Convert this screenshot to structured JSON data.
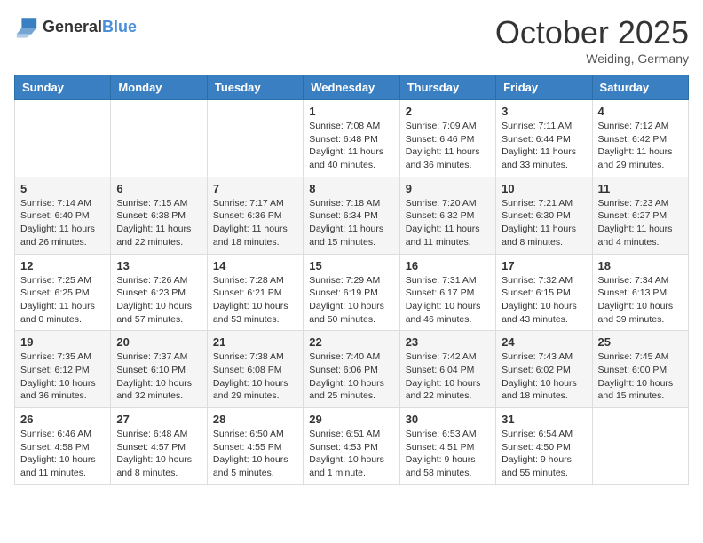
{
  "header": {
    "logo_general": "General",
    "logo_blue": "Blue",
    "month": "October 2025",
    "location": "Weiding, Germany"
  },
  "days_of_week": [
    "Sunday",
    "Monday",
    "Tuesday",
    "Wednesday",
    "Thursday",
    "Friday",
    "Saturday"
  ],
  "weeks": [
    [
      {
        "day": "",
        "info": ""
      },
      {
        "day": "",
        "info": ""
      },
      {
        "day": "",
        "info": ""
      },
      {
        "day": "1",
        "info": "Sunrise: 7:08 AM\nSunset: 6:48 PM\nDaylight: 11 hours and 40 minutes."
      },
      {
        "day": "2",
        "info": "Sunrise: 7:09 AM\nSunset: 6:46 PM\nDaylight: 11 hours and 36 minutes."
      },
      {
        "day": "3",
        "info": "Sunrise: 7:11 AM\nSunset: 6:44 PM\nDaylight: 11 hours and 33 minutes."
      },
      {
        "day": "4",
        "info": "Sunrise: 7:12 AM\nSunset: 6:42 PM\nDaylight: 11 hours and 29 minutes."
      }
    ],
    [
      {
        "day": "5",
        "info": "Sunrise: 7:14 AM\nSunset: 6:40 PM\nDaylight: 11 hours and 26 minutes."
      },
      {
        "day": "6",
        "info": "Sunrise: 7:15 AM\nSunset: 6:38 PM\nDaylight: 11 hours and 22 minutes."
      },
      {
        "day": "7",
        "info": "Sunrise: 7:17 AM\nSunset: 6:36 PM\nDaylight: 11 hours and 18 minutes."
      },
      {
        "day": "8",
        "info": "Sunrise: 7:18 AM\nSunset: 6:34 PM\nDaylight: 11 hours and 15 minutes."
      },
      {
        "day": "9",
        "info": "Sunrise: 7:20 AM\nSunset: 6:32 PM\nDaylight: 11 hours and 11 minutes."
      },
      {
        "day": "10",
        "info": "Sunrise: 7:21 AM\nSunset: 6:30 PM\nDaylight: 11 hours and 8 minutes."
      },
      {
        "day": "11",
        "info": "Sunrise: 7:23 AM\nSunset: 6:27 PM\nDaylight: 11 hours and 4 minutes."
      }
    ],
    [
      {
        "day": "12",
        "info": "Sunrise: 7:25 AM\nSunset: 6:25 PM\nDaylight: 11 hours and 0 minutes."
      },
      {
        "day": "13",
        "info": "Sunrise: 7:26 AM\nSunset: 6:23 PM\nDaylight: 10 hours and 57 minutes."
      },
      {
        "day": "14",
        "info": "Sunrise: 7:28 AM\nSunset: 6:21 PM\nDaylight: 10 hours and 53 minutes."
      },
      {
        "day": "15",
        "info": "Sunrise: 7:29 AM\nSunset: 6:19 PM\nDaylight: 10 hours and 50 minutes."
      },
      {
        "day": "16",
        "info": "Sunrise: 7:31 AM\nSunset: 6:17 PM\nDaylight: 10 hours and 46 minutes."
      },
      {
        "day": "17",
        "info": "Sunrise: 7:32 AM\nSunset: 6:15 PM\nDaylight: 10 hours and 43 minutes."
      },
      {
        "day": "18",
        "info": "Sunrise: 7:34 AM\nSunset: 6:13 PM\nDaylight: 10 hours and 39 minutes."
      }
    ],
    [
      {
        "day": "19",
        "info": "Sunrise: 7:35 AM\nSunset: 6:12 PM\nDaylight: 10 hours and 36 minutes."
      },
      {
        "day": "20",
        "info": "Sunrise: 7:37 AM\nSunset: 6:10 PM\nDaylight: 10 hours and 32 minutes."
      },
      {
        "day": "21",
        "info": "Sunrise: 7:38 AM\nSunset: 6:08 PM\nDaylight: 10 hours and 29 minutes."
      },
      {
        "day": "22",
        "info": "Sunrise: 7:40 AM\nSunset: 6:06 PM\nDaylight: 10 hours and 25 minutes."
      },
      {
        "day": "23",
        "info": "Sunrise: 7:42 AM\nSunset: 6:04 PM\nDaylight: 10 hours and 22 minutes."
      },
      {
        "day": "24",
        "info": "Sunrise: 7:43 AM\nSunset: 6:02 PM\nDaylight: 10 hours and 18 minutes."
      },
      {
        "day": "25",
        "info": "Sunrise: 7:45 AM\nSunset: 6:00 PM\nDaylight: 10 hours and 15 minutes."
      }
    ],
    [
      {
        "day": "26",
        "info": "Sunrise: 6:46 AM\nSunset: 4:58 PM\nDaylight: 10 hours and 11 minutes."
      },
      {
        "day": "27",
        "info": "Sunrise: 6:48 AM\nSunset: 4:57 PM\nDaylight: 10 hours and 8 minutes."
      },
      {
        "day": "28",
        "info": "Sunrise: 6:50 AM\nSunset: 4:55 PM\nDaylight: 10 hours and 5 minutes."
      },
      {
        "day": "29",
        "info": "Sunrise: 6:51 AM\nSunset: 4:53 PM\nDaylight: 10 hours and 1 minute."
      },
      {
        "day": "30",
        "info": "Sunrise: 6:53 AM\nSunset: 4:51 PM\nDaylight: 9 hours and 58 minutes."
      },
      {
        "day": "31",
        "info": "Sunrise: 6:54 AM\nSunset: 4:50 PM\nDaylight: 9 hours and 55 minutes."
      },
      {
        "day": "",
        "info": ""
      }
    ]
  ]
}
